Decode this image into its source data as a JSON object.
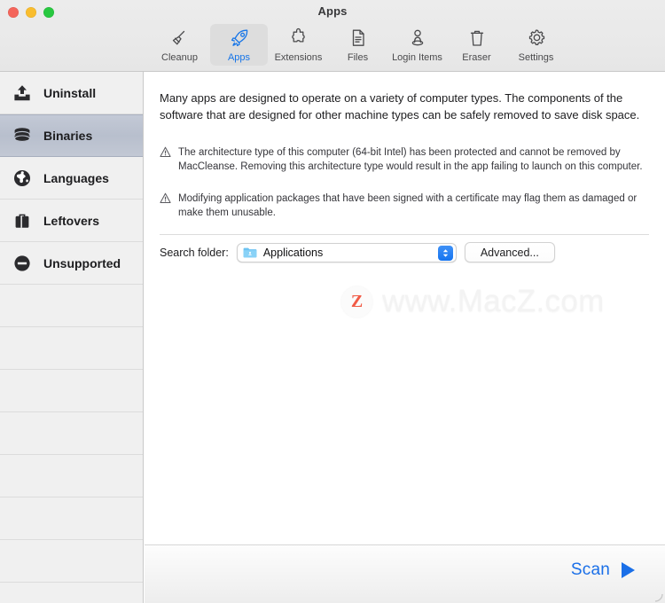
{
  "window": {
    "title": "Apps",
    "traffic_lights": [
      {
        "name": "close",
        "color": "#f4655b"
      },
      {
        "name": "minimize",
        "color": "#f9bd2e"
      },
      {
        "name": "zoom",
        "color": "#28c840"
      }
    ]
  },
  "toolbar": {
    "items": [
      {
        "label": "Cleanup",
        "icon": "broom-icon",
        "selected": false
      },
      {
        "label": "Apps",
        "icon": "rocket-icon",
        "selected": true
      },
      {
        "label": "Extensions",
        "icon": "puzzle-icon",
        "selected": false
      },
      {
        "label": "Files",
        "icon": "document-icon",
        "selected": false
      },
      {
        "label": "Login Items",
        "icon": "person-icon",
        "selected": false
      },
      {
        "label": "Eraser",
        "icon": "trash-icon",
        "selected": false
      },
      {
        "label": "Settings",
        "icon": "gear-icon",
        "selected": false
      }
    ],
    "selected_color": "#1675e8"
  },
  "sidebar": {
    "items": [
      {
        "label": "Uninstall",
        "icon": "uninstall-arrow-icon",
        "selected": false
      },
      {
        "label": "Binaries",
        "icon": "database-icon",
        "selected": true
      },
      {
        "label": "Languages",
        "icon": "globe-icon",
        "selected": false
      },
      {
        "label": "Leftovers",
        "icon": "briefcase-icon",
        "selected": false
      },
      {
        "label": "Unsupported",
        "icon": "minus-circle-icon",
        "selected": false
      }
    ],
    "empty_row_count": 7,
    "selection_color": "#bcc3d0"
  },
  "main": {
    "intro": "Many apps are designed to operate on a variety of computer types. The components of the software that are designed for other machine types can be safely removed to save disk space.",
    "warnings": [
      {
        "icon": "warning-triangle-icon",
        "text": "The architecture type of this computer (64-bit Intel) has been protected and cannot be removed by MacCleanse. Removing this architecture type would result in the app failing to launch on this computer."
      },
      {
        "icon": "warning-triangle-icon",
        "text": "Modifying application packages that have been signed with a certificate may flag them as damaged or make them unusable."
      }
    ],
    "search_folder": {
      "label": "Search folder:",
      "value": "Applications",
      "icon": "folder-icon",
      "chevron_icon": "chevron-up-down-icon",
      "advanced_button": "Advanced..."
    }
  },
  "watermark": {
    "badge_letter": "Z",
    "text": "www.MacZ.com",
    "badge_color": "#f04e37"
  },
  "footer": {
    "scan_label": "Scan",
    "scan_icon": "play-triangle-icon",
    "accent_color": "#1a6fe8"
  }
}
